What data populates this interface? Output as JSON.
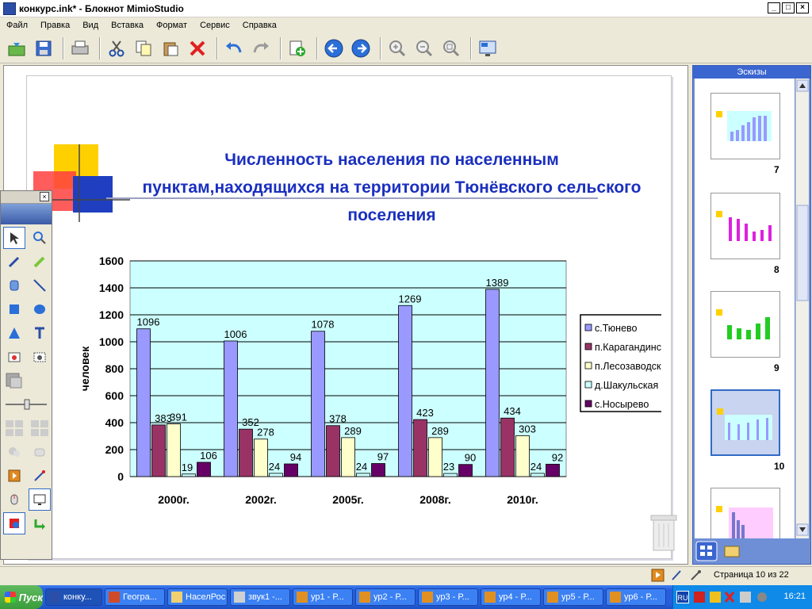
{
  "window": {
    "title": "конкурс.ink* - Блокнот MimioStudio",
    "controls": [
      "_",
      "□",
      "×"
    ]
  },
  "menu": [
    "Файл",
    "Правка",
    "Вид",
    "Вставка",
    "Формат",
    "Сервис",
    "Справка"
  ],
  "toolbar_icons": [
    "open-icon",
    "save-icon",
    "print-icon",
    "cut-icon",
    "copy-icon",
    "paste-icon",
    "delete-icon",
    "undo-icon",
    "redo-icon",
    "new-page-icon",
    "back-icon",
    "forward-icon",
    "zoom-in-icon",
    "zoom-out-icon",
    "zoom-fit-icon",
    "screen-icon"
  ],
  "slide": {
    "title": "Численность населения по населенным пунктам,находящихся на территории Тюнёвского сельского поселения"
  },
  "chart_data": {
    "type": "bar",
    "categories": [
      "2000г.",
      "2002г.",
      "2005г.",
      "2008г.",
      "2010г."
    ],
    "series": [
      {
        "name": "с.Тюнево",
        "color": "#9999ff",
        "values": [
          1096,
          1006,
          1078,
          1269,
          1389
        ]
      },
      {
        "name": "п.Карагандинский",
        "color": "#993366",
        "values": [
          383,
          352,
          378,
          423,
          434
        ]
      },
      {
        "name": "п.Лесозаводский",
        "color": "#ffffcc",
        "values": [
          391,
          278,
          289,
          289,
          303
        ]
      },
      {
        "name": "д.Шакульская",
        "color": "#ccffff",
        "values": [
          19,
          24,
          24,
          23,
          24
        ]
      },
      {
        "name": "с.Носырево",
        "color": "#660066",
        "values": [
          106,
          94,
          97,
          90,
          92
        ]
      }
    ],
    "ylabel": "человек",
    "ylim": [
      0,
      1600
    ],
    "yticks": [
      0,
      200,
      400,
      600,
      800,
      1000,
      1200,
      1400,
      1600
    ],
    "legend": "right",
    "grid": true,
    "plot_bg": "#ccffff"
  },
  "thumbs": {
    "header": "Эскизы",
    "numbers": [
      "7",
      "8",
      "9",
      "10"
    ]
  },
  "status": {
    "page": "Страница 10 из 22"
  },
  "taskbar": {
    "start": "Пуск",
    "items": [
      "конку...",
      "Геогра...",
      "НаселРос",
      "звук1 -...",
      "ур1 - Р...",
      "ур2 - Р...",
      "ур3 - Р...",
      "ур4 - Р...",
      "ур5 - Р...",
      "ур6 - Р..."
    ],
    "lang": "RU",
    "clock": "16:21"
  }
}
